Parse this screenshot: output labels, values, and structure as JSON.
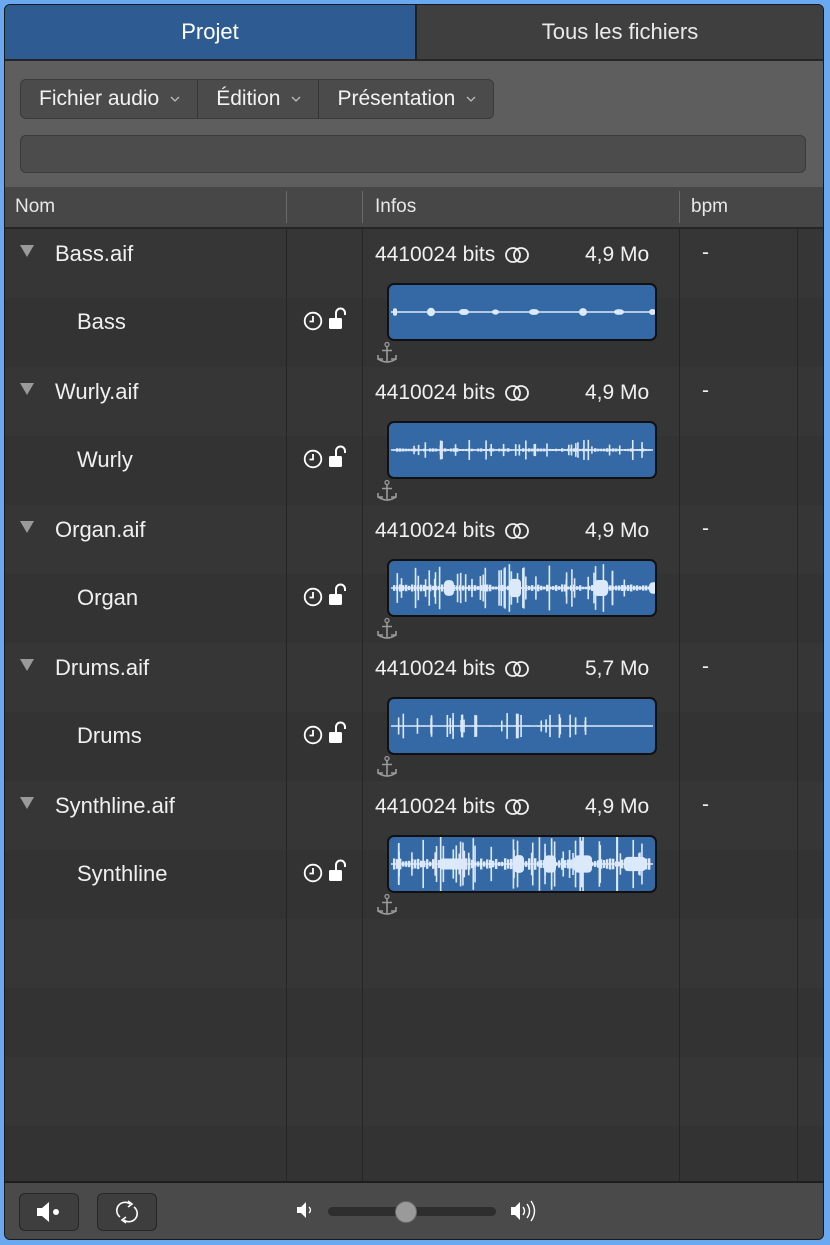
{
  "tabs": [
    {
      "label": "Projet",
      "active": true
    },
    {
      "label": "Tous les fichiers",
      "active": false
    }
  ],
  "menus": [
    {
      "label": "Fichier audio"
    },
    {
      "label": "Édition"
    },
    {
      "label": "Présentation"
    }
  ],
  "search": {
    "value": "",
    "placeholder": ""
  },
  "columns": {
    "name": "Nom",
    "status": "",
    "info": "Infos",
    "bpm": "bpm"
  },
  "files": [
    {
      "file": "Bass.aif",
      "bits": "4410024 bits",
      "size": "4,9 Mo",
      "bpm": "-",
      "region": "Bass",
      "waveform": "bass"
    },
    {
      "file": "Wurly.aif",
      "bits": "4410024 bits",
      "size": "4,9 Mo",
      "bpm": "-",
      "region": "Wurly",
      "waveform": "wurly"
    },
    {
      "file": "Organ.aif",
      "bits": "4410024 bits",
      "size": "4,9 Mo",
      "bpm": "-",
      "region": "Organ",
      "waveform": "organ"
    },
    {
      "file": "Drums.aif",
      "bits": "4410024 bits",
      "size": "5,7 Mo",
      "bpm": "-",
      "region": "Drums",
      "waveform": "drums"
    },
    {
      "file": "Synthline.aif",
      "bits": "4410024 bits",
      "size": "4,9 Mo",
      "bpm": "-",
      "region": "Synthline",
      "waveform": "synth"
    }
  ],
  "icons": {
    "disclosure": "disclosure-triangle-icon",
    "stereo": "stereo-icon",
    "clock": "clock-icon",
    "lock": "unlock-icon",
    "anchor": "anchor-icon",
    "prelisten": "speaker-prelisten-icon",
    "cycle": "cycle-icon",
    "vol_low": "volume-low-icon",
    "vol_high": "volume-high-icon"
  },
  "footer": {
    "volume": 0.46
  },
  "colors": {
    "accent": "#2e5c92",
    "region": "#3569a6",
    "waveform": "#dce9fb"
  }
}
